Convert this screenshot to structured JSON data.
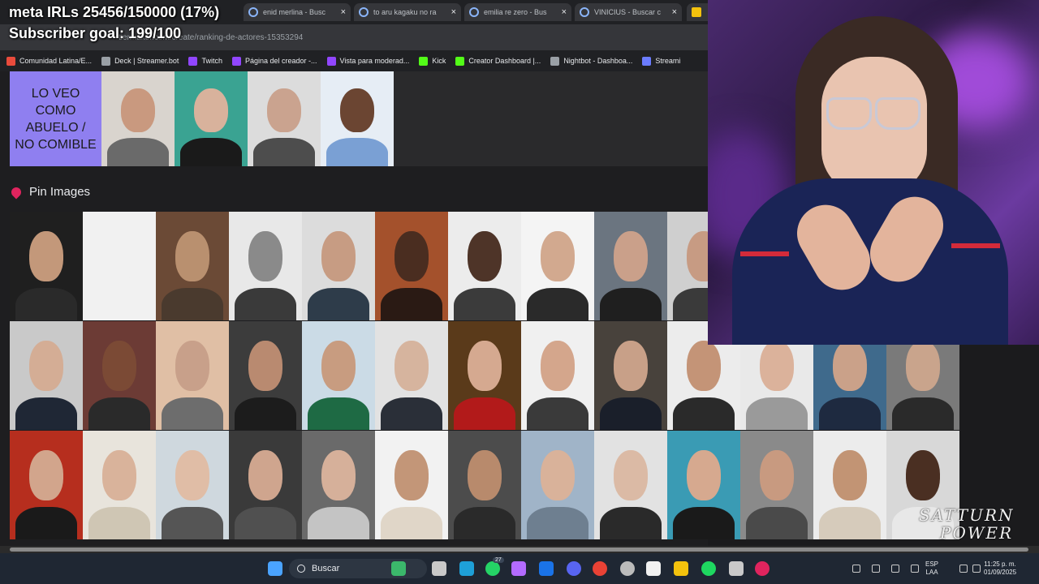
{
  "overlay": {
    "meta_line": "meta IRLs 25456/150000 (17%)",
    "goal_line": "Subscriber goal: 199/100"
  },
  "browser": {
    "tabs": [
      {
        "title": "enid merlina - Busc",
        "close": "×"
      },
      {
        "title": "to aru kagaku no ra",
        "close": "×"
      },
      {
        "title": "emilia re zero - Bus",
        "close": "×"
      },
      {
        "title": "VINICIUS - Buscar c",
        "close": "×"
      }
    ],
    "url": "tiermaker.com/create/ranking-de-actores-15353294",
    "bookmarks": [
      {
        "label": "Comunidad Latina/E...",
        "icon_color": "#e94b3c"
      },
      {
        "label": "Deck | Streamer.bot",
        "icon_color": "#9aa0a6"
      },
      {
        "label": "Twitch",
        "icon_color": "#9146ff"
      },
      {
        "label": "Página del creador -...",
        "icon_color": "#9146ff"
      },
      {
        "label": "Vista para moderad...",
        "icon_color": "#9146ff"
      },
      {
        "label": "Kick",
        "icon_color": "#53fc18"
      },
      {
        "label": "Creator Dashboard |...",
        "icon_color": "#53fc18"
      },
      {
        "label": "Nightbot - Dashboa...",
        "icon_color": "#9aa0a6"
      },
      {
        "label": "Streami",
        "icon_color": "#6b7cff"
      }
    ]
  },
  "tier": {
    "label": "LO VEO COMO ABUELO / NO COMIBLE",
    "label_color": "#8f7ff0",
    "images": [
      {
        "bg": "#d9d4ce",
        "skin": "#c9997f",
        "cloth": "#6a6a6a"
      },
      {
        "bg": "#3aa392",
        "skin": "#d8b29c",
        "cloth": "#1a1a1a"
      },
      {
        "bg": "#dcdcdc",
        "skin": "#caa38f",
        "cloth": "#4d4d4d"
      },
      {
        "bg": "#e6edf5",
        "skin": "#6b4532",
        "cloth": "#7aa0d4"
      }
    ]
  },
  "pin": {
    "title": "Pin Images"
  },
  "grid": [
    [
      {
        "bg": "#1f1f1f",
        "skin": "#c3987a",
        "cloth": "#2a2a2a"
      },
      {
        "bg": "#f1f1f1",
        "skin": "#f1f1f1",
        "cloth": "#f1f1f1"
      },
      {
        "bg": "#6b4a36",
        "skin": "#b9906f",
        "cloth": "#4a3a2e"
      },
      {
        "bg": "#e8e8e8",
        "skin": "#8a8a8a",
        "cloth": "#3a3a3a"
      },
      {
        "bg": "#dcdcdc",
        "skin": "#c79c83",
        "cloth": "#2e3c4a"
      },
      {
        "bg": "#a4512c",
        "skin": "#4a2d20",
        "cloth": "#2a1a14"
      },
      {
        "bg": "#ececec",
        "skin": "#4e3428",
        "cloth": "#3b3b3b"
      },
      {
        "bg": "#f4f4f4",
        "skin": "#d2a98f",
        "cloth": "#2a2a2a"
      },
      {
        "bg": "#6b7580",
        "skin": "#caa08a",
        "cloth": "#1f1f1f"
      },
      {
        "bg": "#cfcfcf",
        "skin": "#c79b83",
        "cloth": "#3a3a3a"
      }
    ],
    [
      {
        "bg": "#c9c9c9",
        "skin": "#d4ad95",
        "cloth": "#1f2735"
      },
      {
        "bg": "#6c3b35",
        "skin": "#7b4a35",
        "cloth": "#2a2a2a"
      },
      {
        "bg": "#e0bfa5",
        "skin": "#c8a08a",
        "cloth": "#6d6d6d"
      },
      {
        "bg": "#3c3c3c",
        "skin": "#b98a70",
        "cloth": "#1c1c1c"
      },
      {
        "bg": "#cbdbe6",
        "skin": "#c89c80",
        "cloth": "#1e6a44"
      },
      {
        "bg": "#e2e2e2",
        "skin": "#d6b49e",
        "cloth": "#2a2f38"
      },
      {
        "bg": "#5a3a1a",
        "skin": "#d5a990",
        "cloth": "#b21a1a"
      },
      {
        "bg": "#f0f0f0",
        "skin": "#d4a68c",
        "cloth": "#3a3a3a"
      },
      {
        "bg": "#48423c",
        "skin": "#c8a088",
        "cloth": "#1a1f2a"
      },
      {
        "bg": "#ececec",
        "skin": "#c49477",
        "cloth": "#2a2a2a"
      },
      {
        "bg": "#e9e9e9",
        "skin": "#dbb29b",
        "cloth": "#9a9a9a"
      },
      {
        "bg": "#3f6a8c",
        "skin": "#caa189",
        "cloth": "#1e2a40"
      },
      {
        "bg": "#7a7a7a",
        "skin": "#c9a48c",
        "cloth": "#2a2a2a"
      }
    ],
    [
      {
        "bg": "#b62e1e",
        "skin": "#d2a58c",
        "cloth": "#1a1a1a"
      },
      {
        "bg": "#e8e4dc",
        "skin": "#d9b39b",
        "cloth": "#cfc6b4"
      },
      {
        "bg": "#cfd8de",
        "skin": "#e0bda6",
        "cloth": "#555555"
      },
      {
        "bg": "#3a3a3a",
        "skin": "#cfa58e",
        "cloth": "#505050"
      },
      {
        "bg": "#6a6a6a",
        "skin": "#d6b09a",
        "cloth": "#c4c4c4"
      },
      {
        "bg": "#f2f2f2",
        "skin": "#c39678",
        "cloth": "#e0d6c8"
      },
      {
        "bg": "#4c4c4c",
        "skin": "#b88a6c",
        "cloth": "#2a2a2a"
      },
      {
        "bg": "#a0b4c8",
        "skin": "#d9b29a",
        "cloth": "#6e7f90"
      },
      {
        "bg": "#e2e2e2",
        "skin": "#dbbaa5",
        "cloth": "#2a2a2a"
      },
      {
        "bg": "#3a9bb4",
        "skin": "#d6a98f",
        "cloth": "#1a1a1a"
      },
      {
        "bg": "#8a8a8a",
        "skin": "#c89a80",
        "cloth": "#4a4a4a"
      },
      {
        "bg": "#ececec",
        "skin": "#c29474",
        "cloth": "#d6cbbb"
      },
      {
        "bg": "#d8d8d8",
        "skin": "#4a2f22",
        "cloth": "#e8e8e8"
      }
    ]
  ],
  "taskbar": {
    "search_placeholder": "Buscar",
    "lang_top": "ESP",
    "lang_bottom": "LAA",
    "time": "11:25 p. m.",
    "date": "01/09/2025",
    "icons": [
      {
        "name": "start-icon",
        "color": "#4aa3ff"
      },
      {
        "name": "widgets-icon",
        "color": "#3bb86b"
      },
      {
        "name": "task-view-icon",
        "color": "#c9c9c9"
      },
      {
        "name": "edge-icon",
        "color": "#1ea0d8"
      },
      {
        "name": "whatsapp-icon",
        "color": "#25d366"
      },
      {
        "name": "copilot-icon",
        "color": "#b36bff"
      },
      {
        "name": "outlook-icon",
        "color": "#1a73e8"
      },
      {
        "name": "discord-icon",
        "color": "#5865f2"
      },
      {
        "name": "chrome-icon",
        "color": "#e94235"
      },
      {
        "name": "obs-icon",
        "color": "#bbbbbb"
      },
      {
        "name": "capcut-icon",
        "color": "#f1f1f1"
      },
      {
        "name": "file-explorer-icon",
        "color": "#f4c20d"
      },
      {
        "name": "spotify-icon",
        "color": "#1ed760"
      },
      {
        "name": "settings-icon",
        "color": "#c9c9c9"
      },
      {
        "name": "app-red-icon",
        "color": "#e0245e"
      }
    ],
    "whatsapp_badge": "27"
  },
  "watermark": {
    "line1": "SATTURN",
    "line2": "POWER"
  }
}
